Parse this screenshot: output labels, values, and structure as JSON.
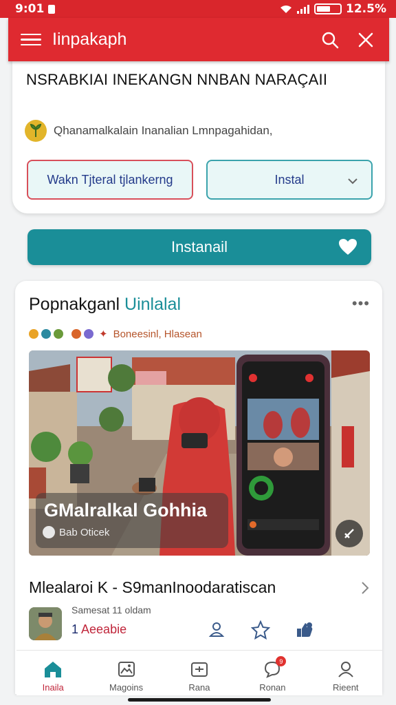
{
  "status_bar": {
    "time": "9:01",
    "battery_percent": "12.5%",
    "battery_level": 0.6
  },
  "app_bar": {
    "title": "Iinpakaph"
  },
  "top_card": {
    "headline": "NSRABKIAI INEKANGN NNBAN NARAÇAII",
    "subtitle": "Qhanamalkalain Inanalian Lmnpagahidan,",
    "button_left": "Wakn Tjteral tjlankerng",
    "button_right": "Instal"
  },
  "install_button": {
    "label": "Instanail"
  },
  "feed_card": {
    "title_part1": "Popnakganl",
    "title_part2": "Uinlalal",
    "more": "•••",
    "meta_text": "Boneesinl, Hlasean",
    "media": {
      "caption_title": "GMalralkal Gohhia",
      "caption_sub": "Bab Oticek"
    },
    "row_title": "Mlealaroi K - S9manInoodaratiscan",
    "author": {
      "subtitle": "Samesat 11 oldam",
      "number": "1",
      "name": "Aeeabie"
    }
  },
  "bottom_nav": [
    {
      "label": "Inaila",
      "icon": "home-icon",
      "active": true
    },
    {
      "label": "Magoins",
      "icon": "gallery-icon",
      "active": false
    },
    {
      "label": "Rana",
      "icon": "calendar-icon",
      "active": false
    },
    {
      "label": "Ronan",
      "icon": "chat-icon",
      "active": false,
      "badge": "9"
    },
    {
      "label": "Rieent",
      "icon": "profile-icon",
      "active": false
    }
  ],
  "colors": {
    "primary_red": "#df2a30",
    "teal": "#1a8e98",
    "accent_text": "#c0253a"
  }
}
